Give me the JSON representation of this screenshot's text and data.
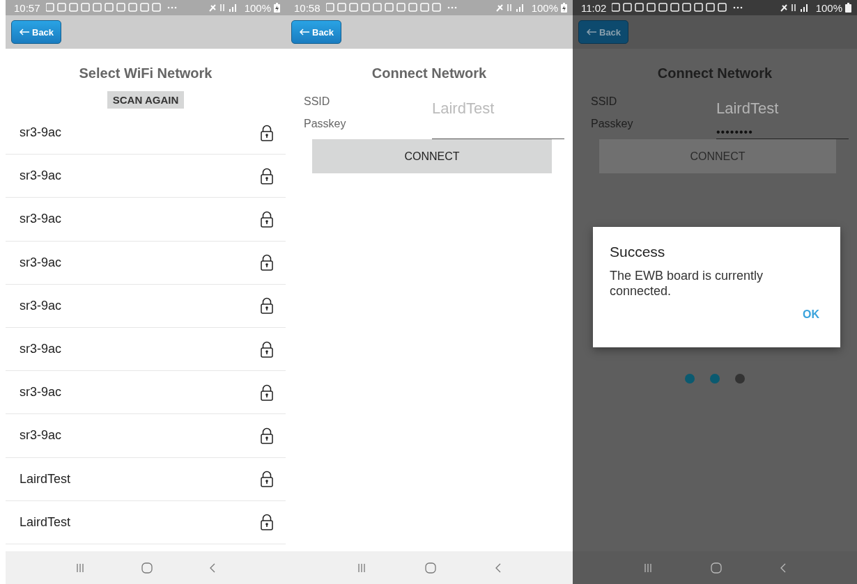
{
  "screens": [
    {
      "kind": "network_list",
      "status_bar": {
        "time": "10:57",
        "battery": "100%",
        "charging": true
      },
      "back_button": {
        "label": "Back"
      },
      "title": "Select WiFi Network",
      "scan_button": {
        "label": "SCAN AGAIN"
      },
      "networks": [
        {
          "name": "sr3-9ac",
          "locked": true
        },
        {
          "name": "sr3-9ac",
          "locked": true
        },
        {
          "name": "sr3-9ac",
          "locked": true
        },
        {
          "name": "sr3-9ac",
          "locked": true
        },
        {
          "name": "sr3-9ac",
          "locked": true
        },
        {
          "name": "sr3-9ac",
          "locked": true
        },
        {
          "name": "sr3-9ac",
          "locked": true
        },
        {
          "name": "sr3-9ac",
          "locked": true
        },
        {
          "name": "LairdTest",
          "locked": true
        },
        {
          "name": "LairdTest",
          "locked": true
        }
      ]
    },
    {
      "kind": "connect",
      "status_bar": {
        "time": "10:58",
        "battery": "100%",
        "charging": true
      },
      "back_button": {
        "label": "Back"
      },
      "title": "Connect Network",
      "ssid_label": "SSID",
      "ssid_value": "LairdTest",
      "passkey_label": "Passkey",
      "connect_button": {
        "label": "CONNECT"
      }
    },
    {
      "kind": "connect",
      "status_bar": {
        "time": "11:02",
        "battery": "100%",
        "charging": false
      },
      "back_button": {
        "label": "Back"
      },
      "title": "Connect Network",
      "ssid_label": "SSID",
      "ssid_value": "LairdTest",
      "passkey_label": "Passkey",
      "passkey_value": "••••••••",
      "connect_button": {
        "label": "CONNECT"
      },
      "dimmed": true,
      "dialog": {
        "title": "Success",
        "message": "The EWB board is currently connected.",
        "button": "OK"
      },
      "progress_dots": [
        {
          "color": "#0b5a70"
        },
        {
          "color": "#0b5a70"
        },
        {
          "color": "#333333"
        }
      ]
    }
  ]
}
